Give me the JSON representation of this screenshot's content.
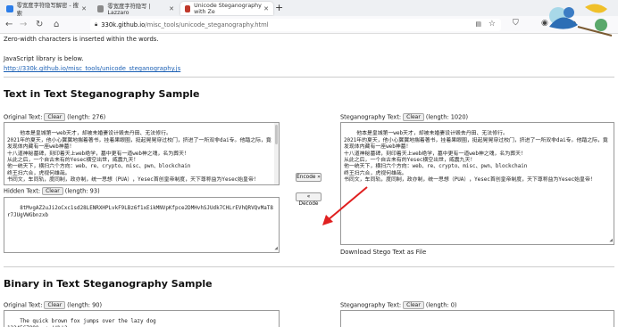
{
  "browser": {
    "tabs": [
      {
        "title": "零宽度字符隐写解密 - 搜索",
        "favicon_color": "#2b7de9"
      },
      {
        "title": "零宽度字符隐写 | Lazzaro",
        "favicon_color": "#8a8a8a"
      },
      {
        "title": "Unicode Steganography with Ze",
        "favicon_color": "#c0392b"
      }
    ],
    "new_tab": "+",
    "url_host": "330k.github.io",
    "url_path": "/misc_tools/unicode_steganography.html",
    "reader_icon": "reader-view-icon",
    "star_icon": "bookmark-star-icon"
  },
  "intro": {
    "line1": "Zero-width characters is inserted within the words.",
    "line2": "JavaScript library is below.",
    "link": "http://330k.github.io/misc_tools/unicode_steganography.js"
  },
  "text_section": {
    "heading": "Text in Text Steganography Sample",
    "original_label": "Original Text:",
    "clear": "Clear",
    "original_length": "(length: 276)",
    "original_text": "他本是皇城第一web天才，却被未婚妻设计毁去丹田、无法修行。\n2021年的夏天，他小心翼翼地揣着著书，挂着果眼圈，挺起晃晃穿过校门，挤进了一所双非dai专。他踏之际，竟发现体内藏有一座web神墓！\n十八道神秘墓碑，刻印着天上web绝学，墓中更有一道web神之魂，名为葬天！\n从此之后，一个自古未有的Yesec横空出世，威震九天！\n他一统天下，横扫六个方向：web、re、crypto、misc、pwn、blockchain\n终王扫六合，虎视何雄哉。\n书同文，车同轨，度同制，政亦制，统一思想（PUA），Yesec首创皇帝制度，天下尊称益为Yesec始皇帝！",
    "hidden_label": "Hidden Text:",
    "hidden_length": "(length: 93)",
    "hidden_text": "8tMvgAZ2uJi2oCxc1sd28LENRXHPLvkF9LBz6f1xEikMNVpKfpce2DMHvhSJUdk7CHLrEVhQRVQvMaT8r7JUgVWGbnzxb",
    "encode_btn": "Encode »",
    "decode_btn": "« Decode",
    "stego_label": "Steganography Text:",
    "stego_length": "(length: 1020)",
    "stego_text": "他本是皇城第一web天才，却被未婚妻设计毁去丹田、无法修行。\n2021年的夏天，他小心翼翼地揣着著书，挂着果眼圈，挺起晃晃穿过校门，挤进了一所双非dai专。他踏之际，竟发现体内藏有一座web神墓！\n十八道神秘墓碑，刻印着天上web绝学，墓中更有一道web神之魂，名为葬天！\n从此之后，一个自古未有的Yesec横空出世，威震九天！\n他一统天下，横扫六个方向：web、re、crypto、misc、pwn、blockchain\n终王扫六合，虎视何雄哉。\n书同文，车同轨，度同制，政亦制，统一思想（PUA），Yesec首创皇帝制度，天下尊称益为Yesec始皇帝！",
    "download": "Download Stego Text as File"
  },
  "binary_section": {
    "heading": "Binary in Text Steganography Sample",
    "original_label": "Original Text:",
    "clear": "Clear",
    "original_length": "(length: 90)",
    "original_text": "The quick brown fox jumps over the lazy dog\n1234567890.,:;!#%!?",
    "stego_label": "Steganography Text:",
    "stego_length": "(length: 0)"
  },
  "colors": {
    "link": "#1a5fb4",
    "arrow": "#e02020",
    "tab_strip": "#eef0f3"
  }
}
